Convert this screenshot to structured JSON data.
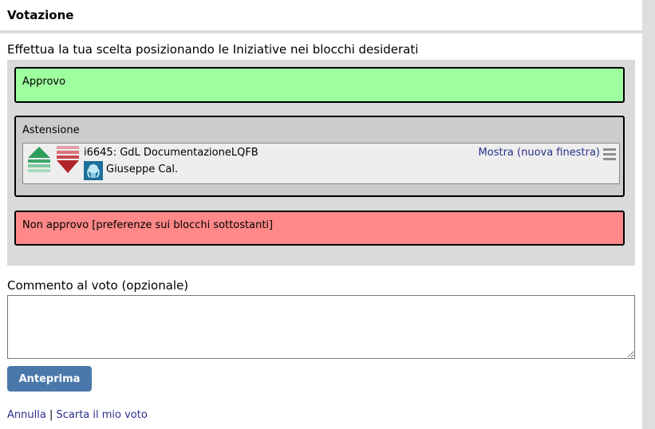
{
  "header": {
    "title": "Votazione"
  },
  "instructions": "Effettua la tua scelta posizionando le Iniziative nei blocchi desiderati",
  "blocks": {
    "approve": {
      "label": "Approvo",
      "color": "#9eff9e"
    },
    "abstain": {
      "label": "Astensione",
      "color": "#cccccc"
    },
    "disapprove": {
      "label": "Non approvo [preferenze sui blocchi sottostanti]",
      "color": "#ff8888"
    }
  },
  "initiative": {
    "title": "i6645: GdL DocumentazioneLQFB",
    "author": "Giuseppe Cal.",
    "show_link": "Mostra (nuova finestra)",
    "icons": [
      "move-up-arrow-icon",
      "move-down-arrow-icon",
      "avatar",
      "drag-handle-icon"
    ]
  },
  "comment": {
    "label": "Commento al voto (opzionale)",
    "value": ""
  },
  "buttons": {
    "preview": "Anteprima"
  },
  "footer": {
    "cancel": "Annulla",
    "separator": "|",
    "discard": "Scarta il mio voto"
  },
  "colors": {
    "accent": "#4a78aa",
    "link": "#2a2f8a",
    "up": "#2e9e5e",
    "down": "#b0242a"
  }
}
